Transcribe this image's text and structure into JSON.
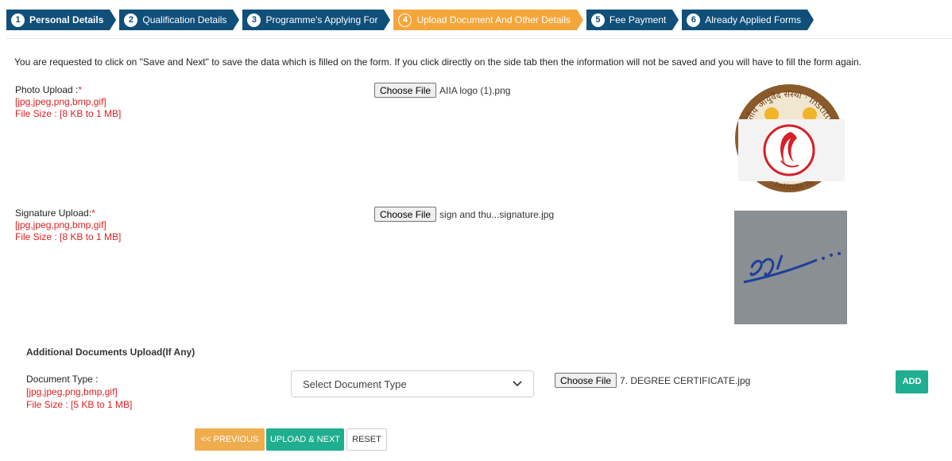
{
  "steps": [
    {
      "num": "1",
      "label": "Personal Details"
    },
    {
      "num": "2",
      "label": "Qualification Details"
    },
    {
      "num": "3",
      "label": "Programme's Applying For"
    },
    {
      "num": "4",
      "label": "Upload Document And Other Details"
    },
    {
      "num": "5",
      "label": "Fee Payment"
    },
    {
      "num": "6",
      "label": "Already Applied Forms"
    }
  ],
  "notice": "You are requested to click on \"Save and Next\" to save the data which is filled on the form. If you click directly on the side tab then the information will not be saved and you will have to fill the form again.",
  "photo": {
    "label": "Photo Upload :",
    "required": "*",
    "formats": "[jpg,jpeg,png,bmp,gif]",
    "size": "File Size : [8 KB to 1 MB]",
    "button": "Choose File",
    "filename": "AIIA logo (1).png",
    "seal_text": "भारतीय आयुर्वेद संस्था · Institute of",
    "seal_text_bottom": "nstitute of"
  },
  "signature": {
    "label": "Signature Upload:",
    "required": "*",
    "formats": "[jpg,jpeg,png,bmp,gif]",
    "size": "File Size : [8 KB to 1 MB]",
    "button": "Choose File",
    "filename": "sign and thu...signature.jpg"
  },
  "additional": {
    "title": "Additional Documents Upload(If Any)",
    "label": "Document Type :",
    "formats": "[jpg,jpeg,png,bmp,gif]",
    "size": "File Size : [5 KB to 1 MB]",
    "select_value": "Select Document Type",
    "button": "Choose File",
    "filename": "7. DEGREE CERTIFICATE.jpg",
    "add": "ADD"
  },
  "actions": {
    "previous": "<< PREVIOUS",
    "upload_next": "UPLOAD & NEXT",
    "reset": "RESET"
  },
  "colors": {
    "tab_done": "#0f4f7a",
    "tab_active": "#f5a63b",
    "accent_green": "#1fae8f",
    "warn_orange": "#f0ad4e",
    "required_red": "#e02020"
  }
}
